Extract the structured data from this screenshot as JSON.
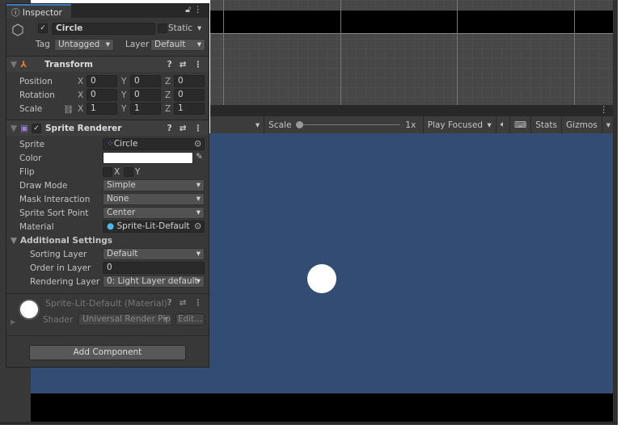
{
  "inspector": {
    "tab_label": "Inspector",
    "object_name": "Circle",
    "static_label": "Static",
    "tag_label": "Tag",
    "tag_value": "Untagged",
    "layer_label": "Layer",
    "layer_value": "Default"
  },
  "transform": {
    "title": "Transform",
    "rows": [
      {
        "label": "Position",
        "x": "0",
        "y": "0",
        "z": "0"
      },
      {
        "label": "Rotation",
        "x": "0",
        "y": "0",
        "z": "0"
      },
      {
        "label": "Scale",
        "x": "1",
        "y": "1",
        "z": "1"
      }
    ]
  },
  "axes": {
    "x": "X",
    "y": "Y",
    "z": "Z"
  },
  "sprite_renderer": {
    "title": "Sprite Renderer",
    "sprite_label": "Sprite",
    "sprite_value": "Circle",
    "color_label": "Color",
    "color_value": "#ffffff",
    "flip_label": "Flip",
    "flip_x": "X",
    "flip_y": "Y",
    "draw_mode_label": "Draw Mode",
    "draw_mode_value": "Simple",
    "mask_label": "Mask Interaction",
    "mask_value": "None",
    "sort_point_label": "Sprite Sort Point",
    "sort_point_value": "Center",
    "material_label": "Material",
    "material_value": "Sprite-Lit-Default",
    "additional_settings": "Additional Settings",
    "sorting_layer_label": "Sorting Layer",
    "sorting_layer_value": "Default",
    "order_label": "Order in Layer",
    "order_value": "0",
    "rendering_layer_label": "Rendering Layer M",
    "rendering_layer_value": "0: Light Layer default"
  },
  "material": {
    "title": "Sprite-Lit-Default (Material)",
    "shader_label": "Shader",
    "shader_value": "Universal Render Pip",
    "edit_label": "Edit..."
  },
  "add_component": "Add Component",
  "game_toolbar": {
    "scale_label": "Scale",
    "scale_value": "1x",
    "play_mode": "Play Focused",
    "stats": "Stats",
    "gizmos": "Gizmos"
  },
  "colors": {
    "game_background": "#324c73",
    "accent": "#3a79bb"
  }
}
